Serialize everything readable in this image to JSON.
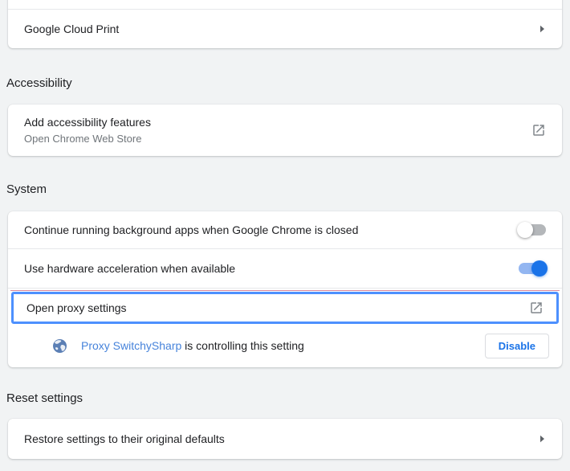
{
  "colors": {
    "page_bg": "#f1f3f4",
    "accent_blue": "#1a73e8",
    "focus_ring_blue": "#4d90fe",
    "link_blue": "#4683db",
    "toggle_on_track": "#93b6f1",
    "toggle_off_track": "#b4b7ba",
    "secondary_text": "#70757a"
  },
  "cloud_print": {
    "label": "Google Cloud Print",
    "trailing_icon": "chevron-right-icon"
  },
  "accessibility": {
    "heading": "Accessibility",
    "row": {
      "label": "Add accessibility features",
      "sublabel": "Open Chrome Web Store",
      "trailing_icon": "external-link-icon"
    }
  },
  "system": {
    "heading": "System",
    "background_apps_row": {
      "label": "Continue running background apps when Google Chrome is closed",
      "toggle_state": "off"
    },
    "hardware_accel_row": {
      "label": "Use hardware acceleration when available",
      "toggle_state": "on"
    },
    "proxy_row": {
      "label": "Open proxy settings",
      "trailing_icon": "external-link-icon",
      "focused": true
    },
    "extension_row": {
      "icon": "globe-icon",
      "link_text": "Proxy SwitchySharp",
      "text": " is controlling this setting",
      "button_label": "Disable"
    }
  },
  "reset": {
    "heading": "Reset settings",
    "row": {
      "label": "Restore settings to their original defaults",
      "trailing_icon": "chevron-right-icon"
    }
  }
}
